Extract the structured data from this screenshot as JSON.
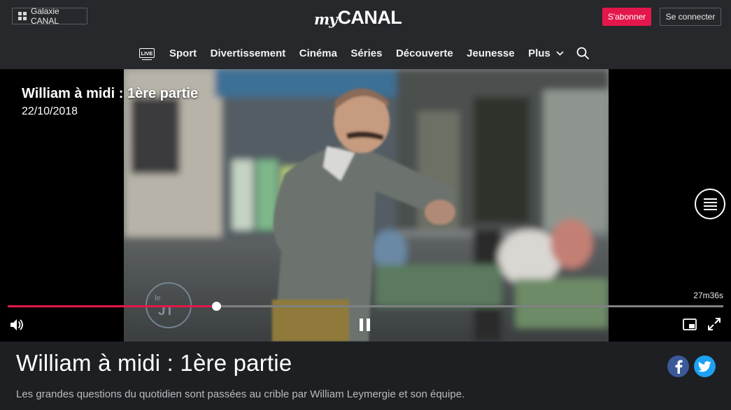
{
  "header": {
    "galaxie_label": "Galaxie CANAL",
    "logo": {
      "prefix": "my",
      "brand": "CANAL"
    },
    "subscribe_label": "S'abonner",
    "login_label": "Se connecter"
  },
  "nav": {
    "live_label": "LIVE",
    "items": [
      "Sport",
      "Divertissement",
      "Cinéma",
      "Séries",
      "Découverte",
      "Jeunesse"
    ],
    "more_label": "Plus",
    "search_icon": "search-icon"
  },
  "player": {
    "title": "William à midi : 1ère partie",
    "date": "22/10/2018",
    "duration": "27m36s",
    "progress": 0.291,
    "channel_badge": "le JT"
  },
  "info": {
    "title": "William à midi : 1ère partie",
    "description": "Les grandes questions du quotidien sont passées au crible par William Leymergie et son équipe."
  },
  "colors": {
    "accent": "#e3174b",
    "facebook": "#3b5998",
    "twitter": "#1da1f2",
    "background": "#1d1f23"
  }
}
